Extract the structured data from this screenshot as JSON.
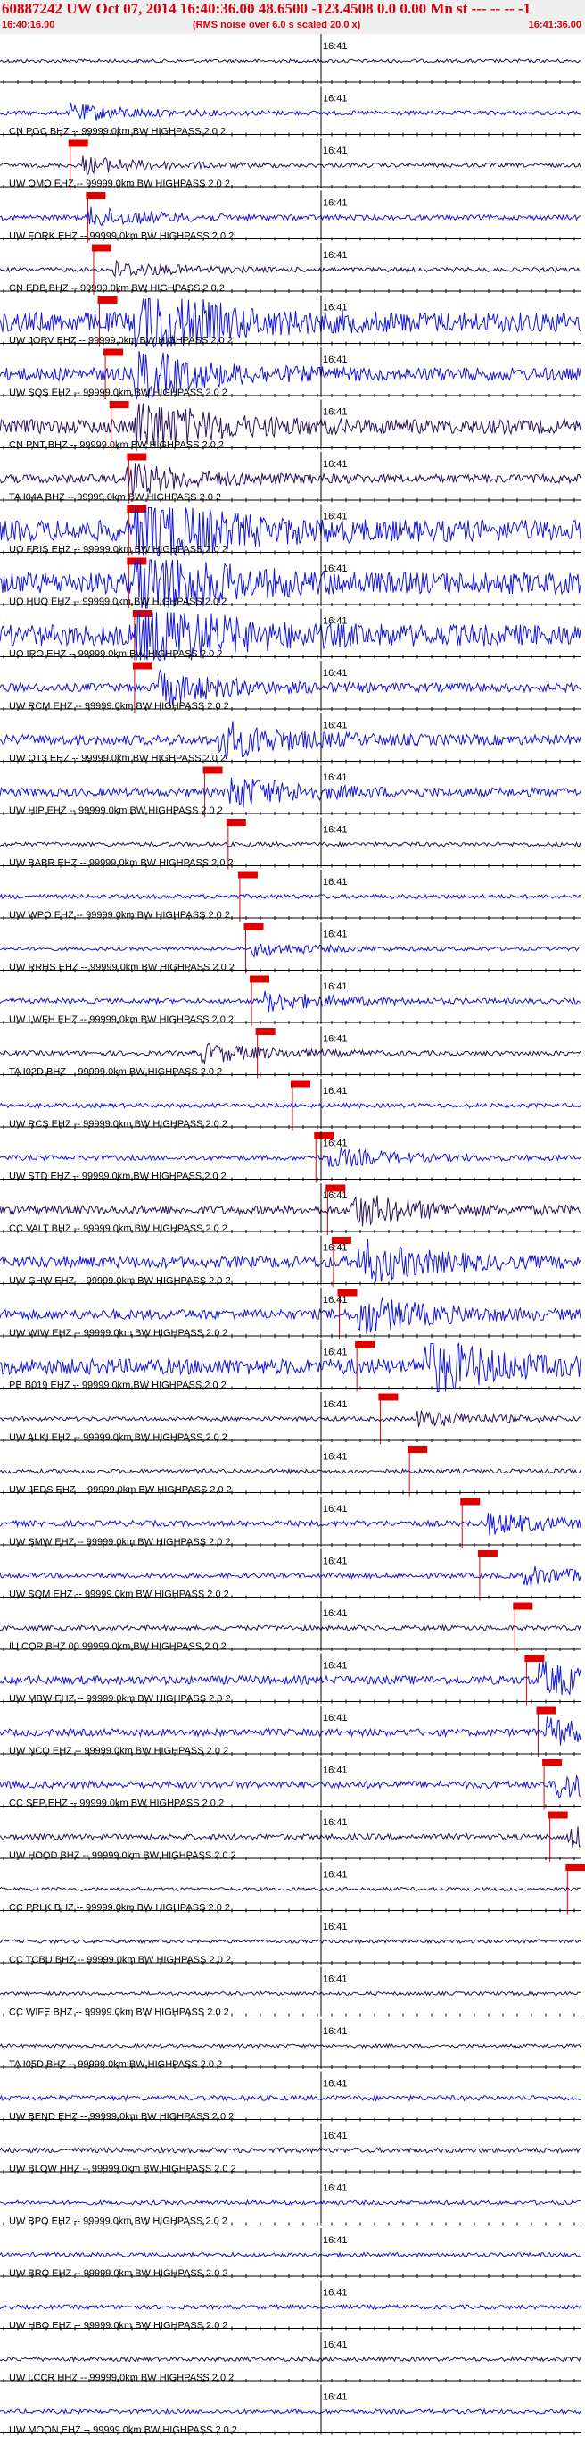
{
  "header": {
    "title": "60887242 UW Oct 07, 2014 16:40:36.00   48.6500  -123.4508   0.0 0.00 Mn st --- -- -- -1",
    "start_time": "16:40:16.00",
    "end_time": "16:41:36.00",
    "note": "(RMS noise over 6.0 s scaled 20.0 x)"
  },
  "colors": {
    "header_bg": "#f0efef",
    "text": "#d3000f",
    "trace_blue": "#1414d6",
    "trace_dark": "#28105a",
    "pick": "#e00000",
    "axis": "#000000"
  },
  "chart_data": {
    "type": "seismogram",
    "time_label": "16:41",
    "traces": [
      {
        "label": "",
        "amp": 0.25,
        "color": "dark",
        "burst": null,
        "pick": null
      },
      {
        "label": "CN PGC BHZ -- 99999.0km BW  HIGHPASS  2.0  2",
        "amp": 0.3,
        "color": "blue",
        "burst": 0.13,
        "pick": 0.12
      },
      {
        "label": "UW OMO EHZ -- 99999.0km BW  HIGHPASS  2.0  2",
        "amp": 0.3,
        "color": "dark",
        "burst": 0.15,
        "pick": 0.15
      },
      {
        "label": "UW FORK EHZ -- 99999.0km BW  HIGHPASS  2.0  2",
        "amp": 0.35,
        "color": "blue",
        "burst": 0.16,
        "pick": 0.16
      },
      {
        "label": "CN EDB BHZ -- 99999.0km BW  HIGHPASS  2.0  2",
        "amp": 0.3,
        "color": "dark",
        "burst": 0.2,
        "pick": 0.17
      },
      {
        "label": "UW JORV EHZ -- 99999.0km BW  HIGHPASS  2.0  2",
        "amp": 1.4,
        "color": "blue",
        "burst": 0.24,
        "pick": 0.18
      },
      {
        "label": "UW SQS EHZ -- 99999.0km BW  HIGHPASS  2.0  2",
        "amp": 0.9,
        "color": "blue",
        "burst": 0.24,
        "pick": 0.19
      },
      {
        "label": "CN PNT BHZ -- 99999.0km BW  HIGHPASS  2.0  2",
        "amp": 1.0,
        "color": "dark",
        "burst": 0.24,
        "pick": 0.22
      },
      {
        "label": "TA I04A BHZ -- 99999.0km BW  HIGHPASS  2.0  2",
        "amp": 0.6,
        "color": "dark",
        "burst": 0.22,
        "pick": 0.22
      },
      {
        "label": "UO FRIS EHZ -- 99999.0km BW  HIGHPASS  2.0  2",
        "amp": 1.5,
        "color": "blue",
        "burst": 0.24,
        "pick": 0.22
      },
      {
        "label": "UO HUO EHZ -- 99999.0km BW  HIGHPASS  2.0  2",
        "amp": 1.5,
        "color": "blue",
        "burst": 0.24,
        "pick": 0.23
      },
      {
        "label": "UO IRO EHZ -- 99999.0km BW  HIGHPASS  2.0  2",
        "amp": 1.5,
        "color": "blue",
        "burst": 0.24,
        "pick": 0.23
      },
      {
        "label": "UW RCM EHZ -- 99999.0km BW  HIGHPASS  2.0  2",
        "amp": 0.6,
        "color": "blue",
        "burst": 0.28,
        "pick": null
      },
      {
        "label": "UW OT3 EHZ -- 99999.0km BW  HIGHPASS  2.0  2",
        "amp": 0.7,
        "color": "blue",
        "burst": 0.38,
        "pick": 0.35
      },
      {
        "label": "UW HIP EHZ -- 99999.0km BW  HIGHPASS  2.0  2",
        "amp": 0.6,
        "color": "blue",
        "burst": 0.4,
        "pick": 0.39
      },
      {
        "label": "UW BABR EHZ -- 99999.0km BW  HIGHPASS  2.0  2",
        "amp": 0.3,
        "color": "dark",
        "burst": null,
        "pick": 0.41
      },
      {
        "label": "UW WPO EHZ -- 99999.0km BW  HIGHPASS  2.0  2",
        "amp": 0.3,
        "color": "blue",
        "burst": null,
        "pick": 0.42
      },
      {
        "label": "UW RRHS EHZ -- 99999.0km BW  HIGHPASS  2.0  2",
        "amp": 0.25,
        "color": "blue",
        "burst": 0.44,
        "pick": 0.43
      },
      {
        "label": "UW LWFH EHZ -- 99999.0km BW  HIGHPASS  2.0  2",
        "amp": 0.35,
        "color": "blue",
        "burst": 0.46,
        "pick": 0.44
      },
      {
        "label": "TA I02D BHZ -- 99999.0km BW  HIGHPASS  2.0  2",
        "amp": 0.35,
        "color": "dark",
        "burst": 0.35,
        "pick": 0.5
      },
      {
        "label": "UW RCS EHZ -- 99999.0km BW  HIGHPASS  2.0  2",
        "amp": 0.3,
        "color": "blue",
        "burst": null,
        "pick": 0.54
      },
      {
        "label": "UW STD EHZ -- 99999.0km BW  HIGHPASS  2.0  2",
        "amp": 0.35,
        "color": "blue",
        "burst": 0.57,
        "pick": 0.56
      },
      {
        "label": "CC VALT BHZ -- 99999.0km BW  HIGHPASS  2.0  2",
        "amp": 0.6,
        "color": "dark",
        "burst": 0.61,
        "pick": 0.57
      },
      {
        "label": "UW GHW EHZ -- 99999.0km BW  HIGHPASS  2.0  2",
        "amp": 0.8,
        "color": "blue",
        "burst": 0.62,
        "pick": 0.58
      },
      {
        "label": "UW WIW EHZ -- 99999.0km BW  HIGHPASS  2.0  2",
        "amp": 0.7,
        "color": "blue",
        "burst": 0.62,
        "pick": 0.61
      },
      {
        "label": "PB B019 EHZ -- 99999.0km BW  HIGHPASS  2.0  2",
        "amp": 1.1,
        "color": "blue",
        "burst": 0.73,
        "pick": 0.65
      },
      {
        "label": "UW ALKI EHZ -- 99999.0km BW  HIGHPASS  2.0  2",
        "amp": 0.3,
        "color": "dark",
        "burst": 0.72,
        "pick": 0.7
      },
      {
        "label": "UW JEDS EHZ -- 99999.0km BW  HIGHPASS  2.0  2",
        "amp": 0.3,
        "color": "dark",
        "burst": null,
        "pick": 0.79
      },
      {
        "label": "UW SMW EHZ -- 99999.0km BW  HIGHPASS  2.0  2",
        "amp": 0.4,
        "color": "blue",
        "burst": 0.84,
        "pick": 0.82
      },
      {
        "label": "UW SQM EHZ -- 99999.0km BW  HIGHPASS  2.0  2",
        "amp": 0.35,
        "color": "blue",
        "burst": 0.9,
        "pick": 0.88
      },
      {
        "label": "IU COR BHZ 00 99999.0km BW  HIGHPASS  2.0  2",
        "amp": 0.35,
        "color": "dark",
        "burst": null,
        "pick": 0.9
      },
      {
        "label": "UW MBW EHZ -- 99999.0km BW  HIGHPASS  2.0  2",
        "amp": 0.6,
        "color": "blue",
        "burst": 0.93,
        "pick": 0.92
      },
      {
        "label": "UW NCO EHZ -- 99999.0km BW  HIGHPASS  2.0  2",
        "amp": 0.5,
        "color": "blue",
        "burst": 0.94,
        "pick": 0.93
      },
      {
        "label": "CC SEP EHZ -- 99999.0km BW  HIGHPASS  2.0  2",
        "amp": 0.5,
        "color": "blue",
        "burst": 0.96,
        "pick": 0.94
      },
      {
        "label": "UW HOOD BHZ -- 99999.0km BW  HIGHPASS  2.0  2",
        "amp": 0.4,
        "color": "dark",
        "burst": 0.98,
        "pick": 0.97
      },
      {
        "label": "CC PRLK BHZ -- 99999.0km BW  HIGHPASS  2.0  2",
        "amp": 0.25,
        "color": "dark",
        "burst": null,
        "pick": null
      },
      {
        "label": "CC TCBU BHZ -- 99999.0km BW  HIGHPASS  2.0  2",
        "amp": 0.25,
        "color": "dark",
        "burst": null,
        "pick": null
      },
      {
        "label": "CC WIFE BHZ -- 99999.0km BW  HIGHPASS  2.0  2",
        "amp": 0.25,
        "color": "dark",
        "burst": null,
        "pick": null
      },
      {
        "label": "TA I05D BHZ -- 99999.0km BW  HIGHPASS  2.0  2",
        "amp": 0.25,
        "color": "dark",
        "burst": null,
        "pick": null
      },
      {
        "label": "UW BEND EHZ -- 99999.0km BW  HIGHPASS  2.0  2",
        "amp": 0.35,
        "color": "blue",
        "burst": null,
        "pick": null
      },
      {
        "label": "UW BLOW HHZ -- 99999.0km BW  HIGHPASS  2.0  2",
        "amp": 0.35,
        "color": "dark",
        "burst": null,
        "pick": null
      },
      {
        "label": "UW BPO EHZ -- 99999.0km BW  HIGHPASS  2.0  2",
        "amp": 0.3,
        "color": "blue",
        "burst": null,
        "pick": null
      },
      {
        "label": "UW BRO EHZ -- 99999.0km BW  HIGHPASS  2.0  2",
        "amp": 0.3,
        "color": "blue",
        "burst": null,
        "pick": null
      },
      {
        "label": "UW HBO EHZ -- 99999.0km BW  HIGHPASS  2.0  2",
        "amp": 0.3,
        "color": "blue",
        "burst": null,
        "pick": null
      },
      {
        "label": "UW LCCR HHZ -- 99999.0km BW  HIGHPASS  2.0  2",
        "amp": 0.3,
        "color": "dark",
        "burst": null,
        "pick": null
      },
      {
        "label": "UW MOON EHZ -- 99999.0km BW  HIGHPASS  2.0  2",
        "amp": 0.3,
        "color": "blue",
        "burst": null,
        "pick": null
      }
    ]
  }
}
